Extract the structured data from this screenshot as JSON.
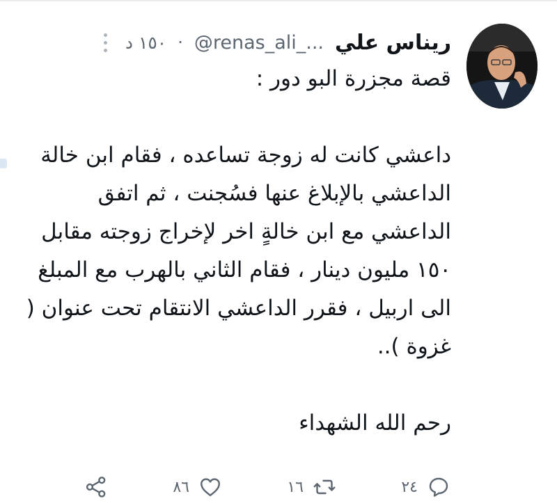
{
  "tweet": {
    "author": {
      "display_name": "ريناس علي",
      "handle": "@renas_ali_...",
      "avatar_icon": "profile-photo"
    },
    "time": "١٥٠ د",
    "text": "قصة مجزرة البو دور :\n\nداعشي كانت له زوجة تساعده ، فقام ابن خالة الداعشي بالإبلاغ عنها فسُجنت ، ثم اتفق الداعشي مع ابن خالةٍ اخر لإخراج زوجته مقابل ١٥٠ مليون دينار ، فقام الثاني بالهرب مع المبلغ الى اربيل ، فقرر الداعشي الانتقام تحت عنوان ( غزوة )..\n\nرحم الله الشهداء",
    "actions": {
      "reply_count": "٢٤",
      "retweet_count": "١٦",
      "like_count": "٨٦"
    }
  },
  "icons": {
    "more": "more-vertical-icon",
    "reply": "reply-icon",
    "retweet": "retweet-icon",
    "like": "heart-icon",
    "share": "share-icon"
  },
  "colors": {
    "text": "#0f1419",
    "secondary": "#5b6670"
  }
}
